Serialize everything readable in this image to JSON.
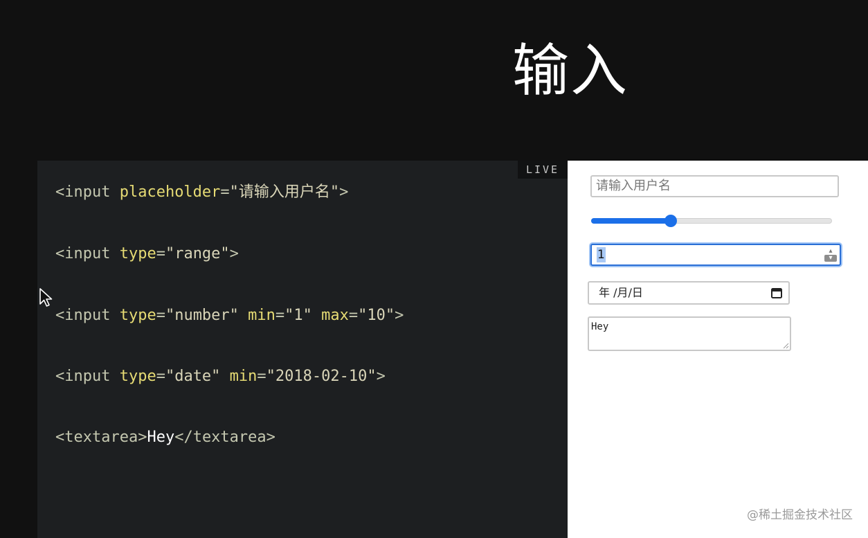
{
  "slide": {
    "title": "输入"
  },
  "editor": {
    "live_badge": "LIVE",
    "lines": [
      [
        {
          "type": "tag",
          "text": "<input "
        },
        {
          "type": "attr",
          "text": "placeholder"
        },
        {
          "type": "tag",
          "text": "="
        },
        {
          "type": "str",
          "text": "\"请输入用户名\""
        },
        {
          "type": "tag",
          "text": ">"
        }
      ],
      [
        {
          "type": "tag",
          "text": "<input "
        },
        {
          "type": "attr",
          "text": "type"
        },
        {
          "type": "tag",
          "text": "="
        },
        {
          "type": "str",
          "text": "\"range\""
        },
        {
          "type": "tag",
          "text": ">"
        }
      ],
      [
        {
          "type": "tag",
          "text": "<input "
        },
        {
          "type": "attr",
          "text": "type"
        },
        {
          "type": "tag",
          "text": "="
        },
        {
          "type": "str",
          "text": "\"number\" "
        },
        {
          "type": "attr",
          "text": "min"
        },
        {
          "type": "tag",
          "text": "="
        },
        {
          "type": "str",
          "text": "\"1\" "
        },
        {
          "type": "attr",
          "text": "max"
        },
        {
          "type": "tag",
          "text": "="
        },
        {
          "type": "str",
          "text": "\"10\""
        },
        {
          "type": "tag",
          "text": ">"
        }
      ],
      [
        {
          "type": "tag",
          "text": "<input "
        },
        {
          "type": "attr",
          "text": "type"
        },
        {
          "type": "tag",
          "text": "="
        },
        {
          "type": "str",
          "text": "\"date\" "
        },
        {
          "type": "attr",
          "text": "min"
        },
        {
          "type": "tag",
          "text": "="
        },
        {
          "type": "str",
          "text": "\"2018-02-10\""
        },
        {
          "type": "tag",
          "text": ">"
        }
      ],
      [
        {
          "type": "tag",
          "text": "<textarea>"
        },
        {
          "type": "text",
          "text": "Hey"
        },
        {
          "type": "tag",
          "text": "</textarea>"
        }
      ]
    ]
  },
  "preview": {
    "text_input": {
      "placeholder": "请输入用户名"
    },
    "range": {
      "value_fraction": 0.33
    },
    "number_input": {
      "value": "1"
    },
    "date_input": {
      "display": "年 /月/日"
    },
    "textarea": {
      "value": "Hey"
    }
  },
  "watermark": "@稀土掘金技术社区",
  "colors": {
    "accent": "#1b6fe8",
    "code_background": "#1d1f21",
    "code_attr": "#e6db74",
    "code_tag": "#c5c8b0"
  }
}
